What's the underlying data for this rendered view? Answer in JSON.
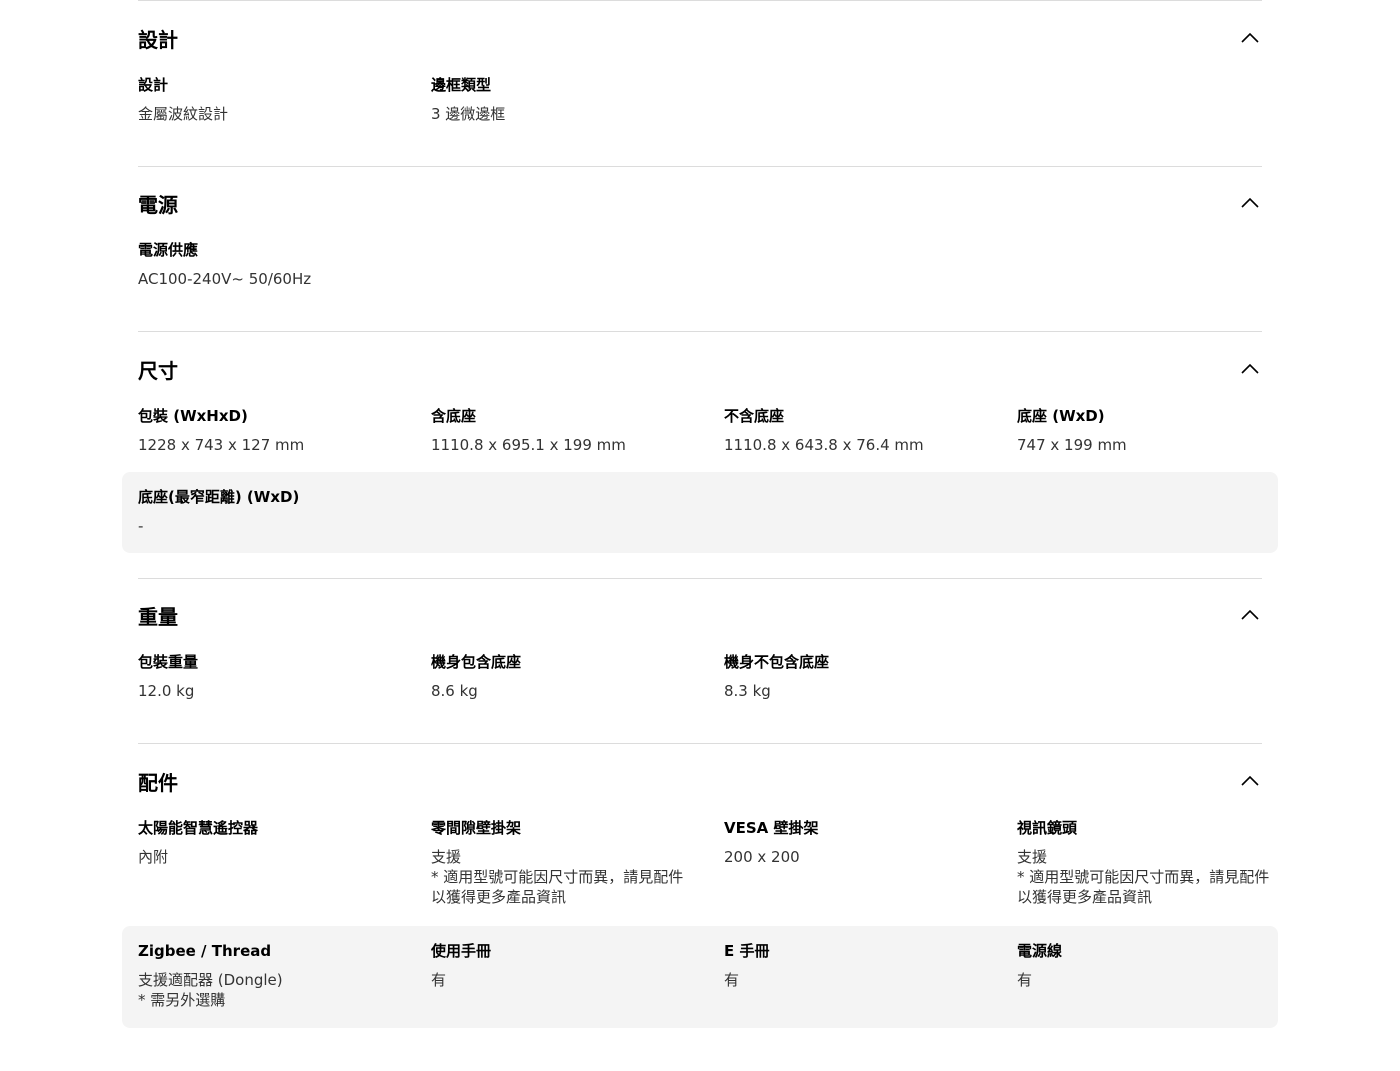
{
  "sections": {
    "design": {
      "title": "設計",
      "items": [
        {
          "label": "設計",
          "value": "金屬波紋設計"
        },
        {
          "label": "邊框類型",
          "value": "3 邊微邊框"
        }
      ]
    },
    "power": {
      "title": "電源",
      "items": [
        {
          "label": "電源供應",
          "value": "AC100-240V~ 50/60Hz"
        }
      ]
    },
    "dimensions": {
      "title": "尺寸",
      "items": [
        {
          "label": "包裝 (WxHxD)",
          "value": "1228 x 743 x 127 mm"
        },
        {
          "label": "含底座",
          "value": "1110.8 x 695.1 x 199 mm"
        },
        {
          "label": "不含底座",
          "value": "1110.8 x 643.8 x 76.4 mm"
        },
        {
          "label": "底座 (WxD)",
          "value": "747 x 199 mm"
        },
        {
          "label": "底座(最窄距離) (WxD)",
          "value": "-"
        }
      ]
    },
    "weight": {
      "title": "重量",
      "items": [
        {
          "label": "包裝重量",
          "value": "12.0 kg"
        },
        {
          "label": "機身包含底座",
          "value": "8.6 kg"
        },
        {
          "label": "機身不包含底座",
          "value": "8.3 kg"
        }
      ]
    },
    "accessories": {
      "title": "配件",
      "items": [
        {
          "label": "太陽能智慧遙控器",
          "value": "內附"
        },
        {
          "label": "零間隙壁掛架",
          "value": "支援\n* 適用型號可能因尺寸而異，請見配件以獲得更多產品資訊"
        },
        {
          "label": "VESA 壁掛架",
          "value": "200 x 200"
        },
        {
          "label": "視訊鏡頭",
          "value": "支援\n* 適用型號可能因尺寸而異，請見配件以獲得更多產品資訊"
        },
        {
          "label": "Zigbee / Thread",
          "value": "支援適配器 (Dongle)\n* 需另外選購"
        },
        {
          "label": "使用手冊",
          "value": "有"
        },
        {
          "label": "E 手冊",
          "value": "有"
        },
        {
          "label": "電源線",
          "value": "有"
        }
      ]
    }
  },
  "icons": {
    "collapse": "chevron-up-icon"
  },
  "colors": {
    "divider": "#dcdcdc",
    "highlight_row": "#f4f4f4",
    "text": "#1a1a1a"
  }
}
